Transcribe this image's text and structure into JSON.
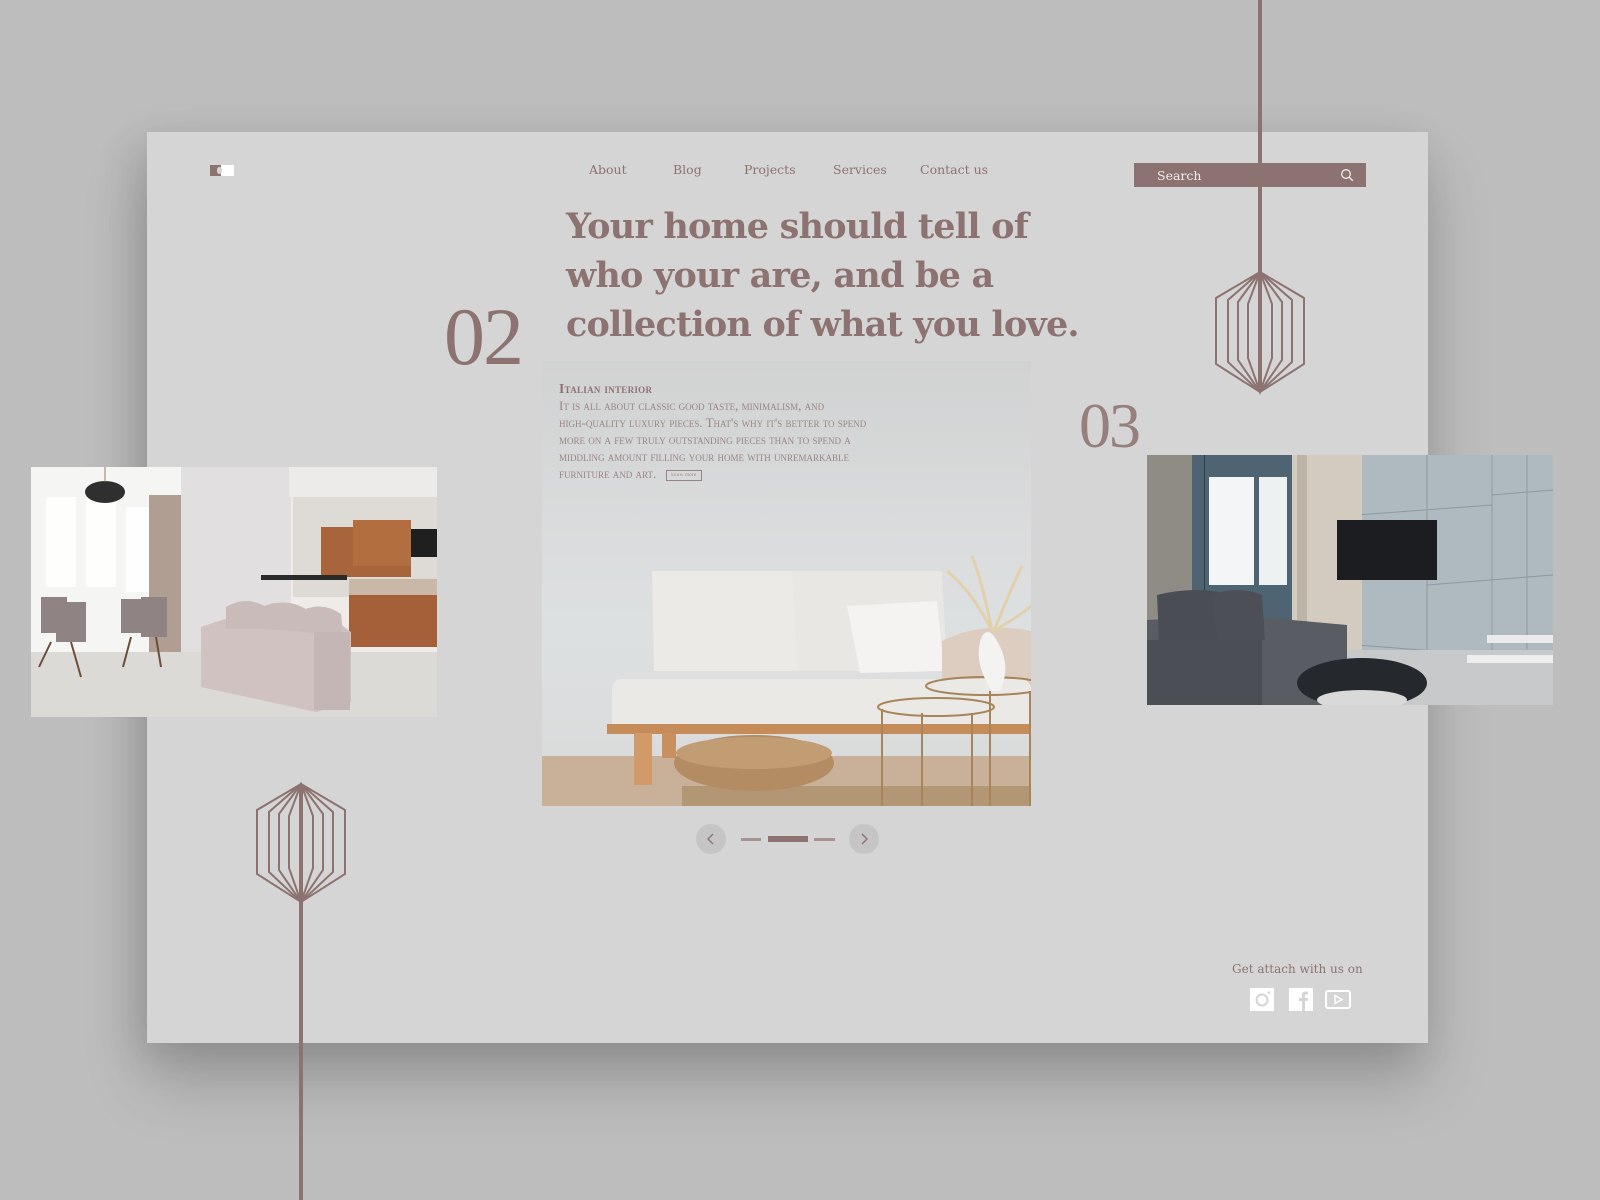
{
  "brand": {
    "logo": "logo-mark"
  },
  "nav": {
    "items": [
      {
        "label": "About"
      },
      {
        "label": "Blog"
      },
      {
        "label": "Projects"
      },
      {
        "label": "Services"
      },
      {
        "label": "Contact us"
      }
    ]
  },
  "search": {
    "placeholder": "Search",
    "value": "",
    "icon": "search-icon"
  },
  "hero": {
    "headline": [
      "Your home should tell of",
      "who your are, and be a",
      "collection of what you love."
    ],
    "current_number": "02",
    "next_number": "03",
    "card_title": "Italian interior",
    "card_body": "It is all about classic good taste, minimalism, and high-quality luxury pieces. That's why it's better to spend more on a few truly outstanding pieces than to spend a middling amount filling your home with unremarkable furniture and art.",
    "card_body_lines": [
      "It is all about classic good taste, minimalism, and",
      "high-quality luxury pieces. That's why it's better to spend",
      "more on a few truly outstanding pieces than to spend a",
      "middling amount filling your home with unremarkable",
      "furniture and art."
    ],
    "know_more_label": "know more"
  },
  "slides": {
    "previous": {
      "alt": "Living room with dining area and wooden kitchen"
    },
    "current": {
      "alt": "Minimal white sofa with wicker pouf and brass side tables"
    },
    "next": {
      "alt": "Grey armchair with wall-mounted TV by large windows"
    }
  },
  "pager": {
    "prev_icon": "chevron-left-icon",
    "next_icon": "chevron-right-icon",
    "total": 3,
    "active_index": 1
  },
  "social": {
    "label": "Get attach with us on",
    "items": [
      {
        "name": "instagram",
        "icon": "instagram-icon"
      },
      {
        "name": "facebook",
        "icon": "facebook-icon"
      },
      {
        "name": "youtube",
        "icon": "youtube-icon"
      }
    ]
  },
  "colors": {
    "accent": "#8c7371",
    "card_background": "#d5d5d5",
    "page_background": "#bdbdbd",
    "text_light": "#f1ecec"
  }
}
